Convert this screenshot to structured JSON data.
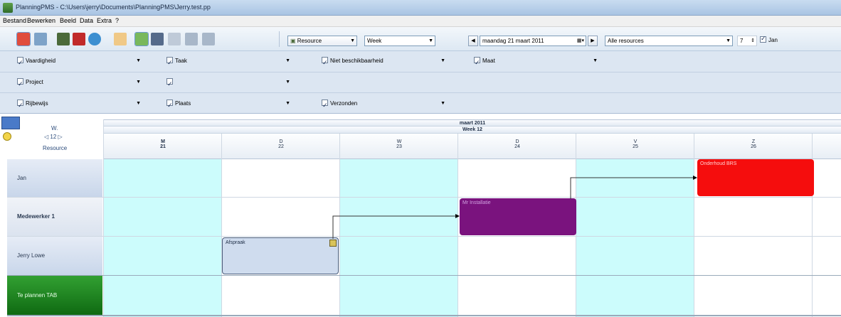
{
  "titlebar": {
    "title": "PlanningPMS - C:\\Users\\jerry\\Documents\\PlanningPMS\\Jerry.test.pp"
  },
  "menu": [
    "Bestand",
    "Bewerken",
    "Beeld",
    "Data",
    "Extra",
    "?"
  ],
  "toolbar": {
    "icons": [
      "new-icon",
      "open-icon",
      "users-icon",
      "book-icon",
      "globe-icon",
      "calendar-icon",
      "refresh-icon",
      "print-icon",
      "line-icon",
      "tree-icon",
      "tree2-icon"
    ],
    "resource_label": "Resource",
    "view_value": "Week",
    "date_value": "maandag 21   maart   2011",
    "resources_value": "Alle resources",
    "spin_value": "7",
    "jan_label": "Jan"
  },
  "filters": {
    "row1": [
      "Vaardigheid",
      "Taak",
      "Niet beschikbaarheid",
      "Maat"
    ],
    "row2": [
      "Project",
      ""
    ],
    "row3": [
      "Rijbewijs",
      "Plaats",
      "Verzonden"
    ]
  },
  "planner": {
    "corner": {
      "week_label": "W.",
      "week_num": "12",
      "resource_label": "Resource"
    },
    "month": "maart 2011",
    "week": "Week 12",
    "days": [
      {
        "abbr": "M",
        "num": "21"
      },
      {
        "abbr": "D",
        "num": "22"
      },
      {
        "abbr": "W",
        "num": "23"
      },
      {
        "abbr": "D",
        "num": "24"
      },
      {
        "abbr": "V",
        "num": "25"
      },
      {
        "abbr": "Z",
        "num": "26"
      }
    ],
    "rows": [
      "Jan",
      "Medewerker 1",
      "Jerry Lowe",
      "Te plannen TAB"
    ],
    "events": [
      {
        "label": "Afspraak",
        "color": "#cfdcee"
      },
      {
        "label": "Mr Installatie",
        "color": "#7a137e"
      },
      {
        "label": "Onderhoud BRS",
        "color": "#f50d0d"
      }
    ]
  },
  "colors": {
    "accent": "#6d9ad1",
    "highlight_col": "#ccfcfc",
    "green_row": "#2a8a2a"
  }
}
